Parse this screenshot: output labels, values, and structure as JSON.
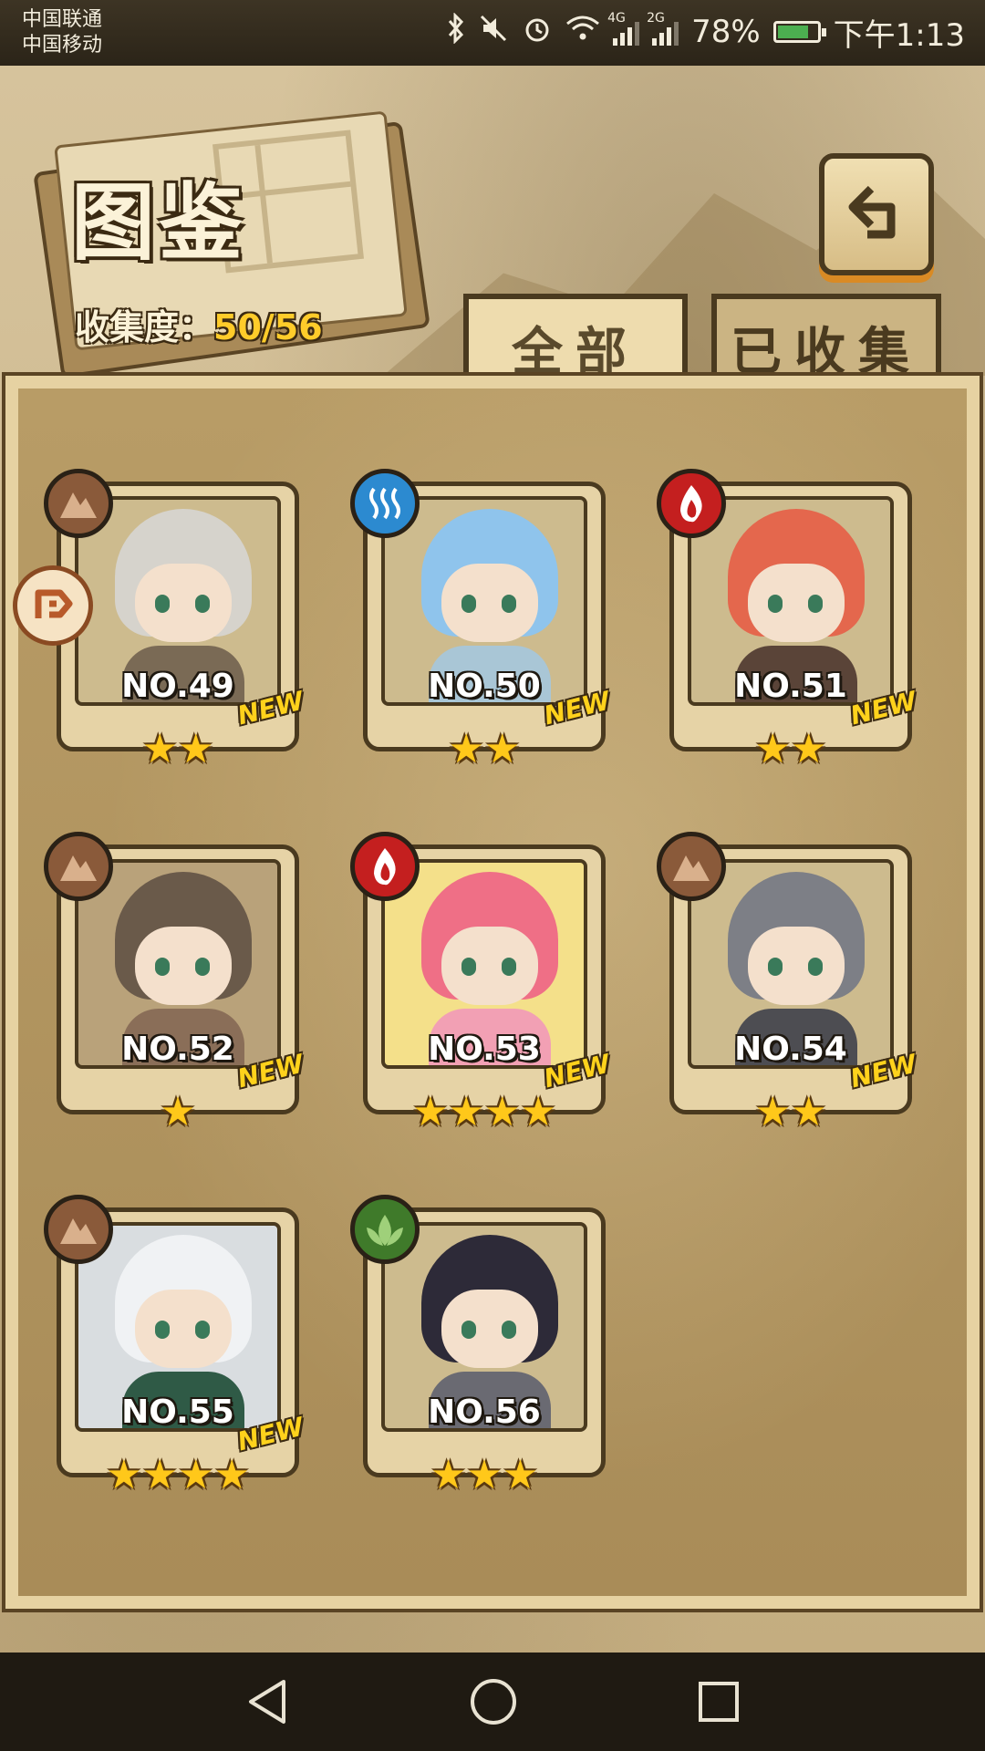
{
  "status_bar": {
    "carrier1": "中国联通",
    "carrier2": "中国移动",
    "signal1_label": "4G",
    "signal2_label": "2G",
    "battery": "78%",
    "time": "下午1:13"
  },
  "header": {
    "title": "图鉴",
    "collection_label": "收集度：",
    "collection_value": "50/56"
  },
  "tabs": [
    {
      "label": "全部",
      "active": true
    },
    {
      "label": "已收集",
      "active": false
    }
  ],
  "cards": [
    {
      "number": "NO.49",
      "stars": 2,
      "star_text": "★★",
      "element": "earth",
      "new": "NEW",
      "hair": "#d6d3cc",
      "body": "#7a6a55",
      "bg": "#cdbb8e"
    },
    {
      "number": "NO.50",
      "stars": 2,
      "star_text": "★★",
      "element": "water",
      "new": "NEW",
      "hair": "#8fc4ec",
      "body": "#a9c6d6",
      "bg": "#cdbb8e"
    },
    {
      "number": "NO.51",
      "stars": 2,
      "star_text": "★★",
      "element": "fire",
      "new": "NEW",
      "hair": "#e4674d",
      "body": "#5a4438",
      "bg": "#cdbb8e"
    },
    {
      "number": "NO.52",
      "stars": 1,
      "star_text": "★",
      "element": "earth",
      "new": "NEW",
      "hair": "#6a5a4a",
      "body": "#8a6e58",
      "bg": "#b9a27a"
    },
    {
      "number": "NO.53",
      "stars": 4,
      "star_text": "★★★★",
      "element": "fire",
      "new": "NEW",
      "hair": "#ef6f86",
      "body": "#f2a0b4",
      "bg": "#f4e08a"
    },
    {
      "number": "NO.54",
      "stars": 2,
      "star_text": "★★",
      "element": "earth",
      "new": "NEW",
      "hair": "#7d7f86",
      "body": "#4d4d52",
      "bg": "#cdbb8e"
    },
    {
      "number": "NO.55",
      "stars": 4,
      "star_text": "★★★★",
      "element": "earth",
      "new": "NEW",
      "hair": "#f0f2f4",
      "body": "#2f5a46",
      "bg": "#d9dde0"
    },
    {
      "number": "NO.56",
      "stars": 3,
      "star_text": "★★★",
      "element": "leaf",
      "new": "",
      "hair": "#2d2a38",
      "body": "#6a6a72",
      "bg": "#cdbb8e"
    }
  ],
  "icons": {
    "back": "back-arrow-icon",
    "nav_back": "triangle-back-icon",
    "nav_home": "circle-home-icon",
    "nav_recent": "square-recent-icon"
  },
  "colors": {
    "accent_gold": "#ffcc2a",
    "frame_dark": "#4a3a1f",
    "panel_light": "#e6d2a2"
  }
}
